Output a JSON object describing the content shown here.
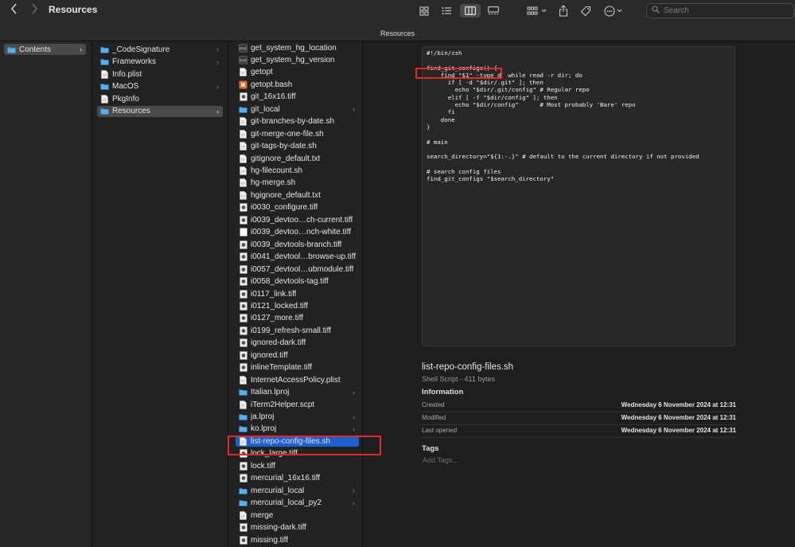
{
  "window": {
    "title": "Resources",
    "path_title": "Resources"
  },
  "search": {
    "placeholder": "Search"
  },
  "toolbar_icons": [
    "back-icon",
    "forward-icon",
    "icon-view-icon",
    "list-view-icon",
    "column-view-icon",
    "gallery-view-icon",
    "group-icon",
    "share-icon",
    "tag-icon",
    "more-actions-icon"
  ],
  "column1": {
    "items": [
      {
        "label": "Contents",
        "type": "folder",
        "selected": true,
        "chevron": true
      }
    ]
  },
  "column2": {
    "items": [
      {
        "label": "_CodeSignature",
        "type": "folder",
        "chevron": true
      },
      {
        "label": "Frameworks",
        "type": "folder",
        "chevron": true
      },
      {
        "label": "Info.plist",
        "type": "file",
        "chevron": false
      },
      {
        "label": "MacOS",
        "type": "folder",
        "chevron": true
      },
      {
        "label": "PkgInfo",
        "type": "file",
        "chevron": false
      },
      {
        "label": "Resources",
        "type": "folder",
        "chevron": true,
        "selected": true
      }
    ]
  },
  "column3": {
    "items": [
      {
        "label": "get_system_hg_location",
        "type": "script"
      },
      {
        "label": "get_system_hg_version",
        "type": "script"
      },
      {
        "label": "getopt",
        "type": "doc"
      },
      {
        "label": "getopt.bash",
        "type": "bash"
      },
      {
        "label": "git_16x16.tiff",
        "type": "image"
      },
      {
        "label": "git_local",
        "type": "folder",
        "chevron": true
      },
      {
        "label": "git-branches-by-date.sh",
        "type": "doc"
      },
      {
        "label": "git-merge-one-file.sh",
        "type": "doc"
      },
      {
        "label": "git-tags-by-date.sh",
        "type": "doc"
      },
      {
        "label": "gitignore_default.txt",
        "type": "doc"
      },
      {
        "label": "hg-filecount.sh",
        "type": "doc"
      },
      {
        "label": "hg-merge.sh",
        "type": "doc"
      },
      {
        "label": "hgignore_default.txt",
        "type": "doc"
      },
      {
        "label": "i0030_configure.tiff",
        "type": "image"
      },
      {
        "label": "i0039_devtoo…ch-current.tiff",
        "type": "image"
      },
      {
        "label": "i0039_devtoo…nch-white.tiff",
        "type": "white"
      },
      {
        "label": "i0039_devtools-branch.tiff",
        "type": "image"
      },
      {
        "label": "i0041_devtool…browse-up.tiff",
        "type": "image"
      },
      {
        "label": "i0057_devtool…ubmodule.tiff",
        "type": "image"
      },
      {
        "label": "i0058_devtools-tag.tiff",
        "type": "image"
      },
      {
        "label": "i0117_link.tiff",
        "type": "image"
      },
      {
        "label": "i0121_locked.tiff",
        "type": "image"
      },
      {
        "label": "i0127_more.tiff",
        "type": "image"
      },
      {
        "label": "i0199_refresh-small.tiff",
        "type": "image"
      },
      {
        "label": "ignored-dark.tiff",
        "type": "image"
      },
      {
        "label": "ignored.tiff",
        "type": "image"
      },
      {
        "label": "inlineTemplate.tiff",
        "type": "image"
      },
      {
        "label": "InternetAccessPolicy.plist",
        "type": "doc"
      },
      {
        "label": "Italian.lproj",
        "type": "folder",
        "chevron": true
      },
      {
        "label": "iTerm2Helper.scpt",
        "type": "doc"
      },
      {
        "label": "ja.lproj",
        "type": "folder",
        "chevron": true
      },
      {
        "label": "ko.lproj",
        "type": "folder",
        "chevron": true
      },
      {
        "label": "list-repo-config-files.sh",
        "type": "doc",
        "selected": true
      },
      {
        "label": "lock_large.tiff",
        "type": "image"
      },
      {
        "label": "lock.tiff",
        "type": "image"
      },
      {
        "label": "mercurial_16x16.tiff",
        "type": "image"
      },
      {
        "label": "mercurial_local",
        "type": "folder",
        "chevron": true
      },
      {
        "label": "mercurial_local_py2",
        "type": "folder",
        "chevron": true
      },
      {
        "label": "merge",
        "type": "doc"
      },
      {
        "label": "missing-dark.tiff",
        "type": "image"
      },
      {
        "label": "missing.tiff",
        "type": "image"
      }
    ]
  },
  "preview": {
    "code": "#!/bin/zsh\n\nfind_git_configs() {\n    find \"$1\" -type d  while read -r dir; do\n      if [ -d \"$dir/.git\" ]; then\n        echo \"$dir/.git/config\" # Regular repo\n      elif [ -f \"$dir/config\" ]; then\n        echo \"$dir/config\"      # Most probably 'Bare' repo\n      fi\n    done\n}\n\n# main\n\nsearch_directory=\"${1:-.}\" # default to the current directory if not provided\n\n# search config files\nfind_git_configs \"$search_directory\"",
    "file_name": "list-repo-config-files.sh",
    "file_kind": "Shell Script - 411 bytes",
    "info_title": "Information",
    "info": [
      {
        "key": "Created",
        "value": "Wednesday 6 November 2024 at 12:31"
      },
      {
        "key": "Modified",
        "value": "Wednesday 6 November 2024 at 12:31"
      },
      {
        "key": "Last opened",
        "value": "Wednesday 6 November 2024 at 12:31"
      }
    ],
    "tags_title": "Tags",
    "tags_placeholder": "Add Tags..."
  },
  "colors": {
    "accent": "#1c5fd4",
    "highlight_box": "#e8252a",
    "folder": "#3a9be0"
  }
}
